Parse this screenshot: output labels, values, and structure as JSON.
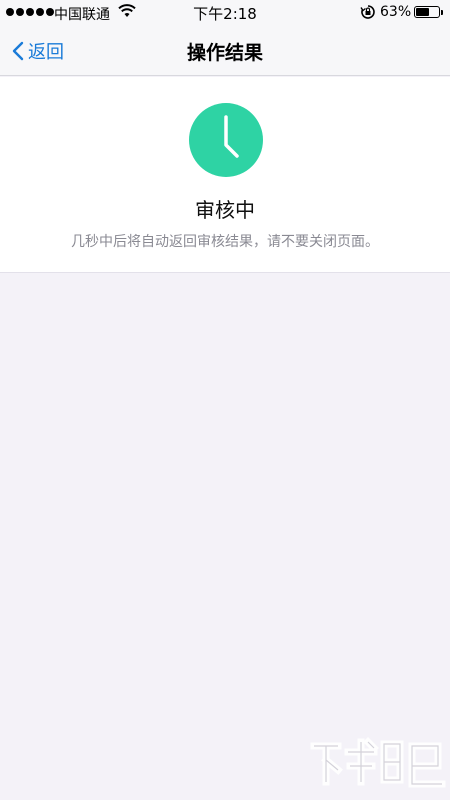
{
  "status_bar": {
    "carrier": "中国联通",
    "time": "下午2:18",
    "battery": "63%",
    "battery_level": 0.63
  },
  "nav": {
    "back_label": "返回",
    "title": "操作结果"
  },
  "result": {
    "status": "审核中",
    "description": "几秒中后将自动返回审核结果，请不要关闭页面。",
    "icon": "clock-icon",
    "accent_color": "#2ed3a4"
  }
}
